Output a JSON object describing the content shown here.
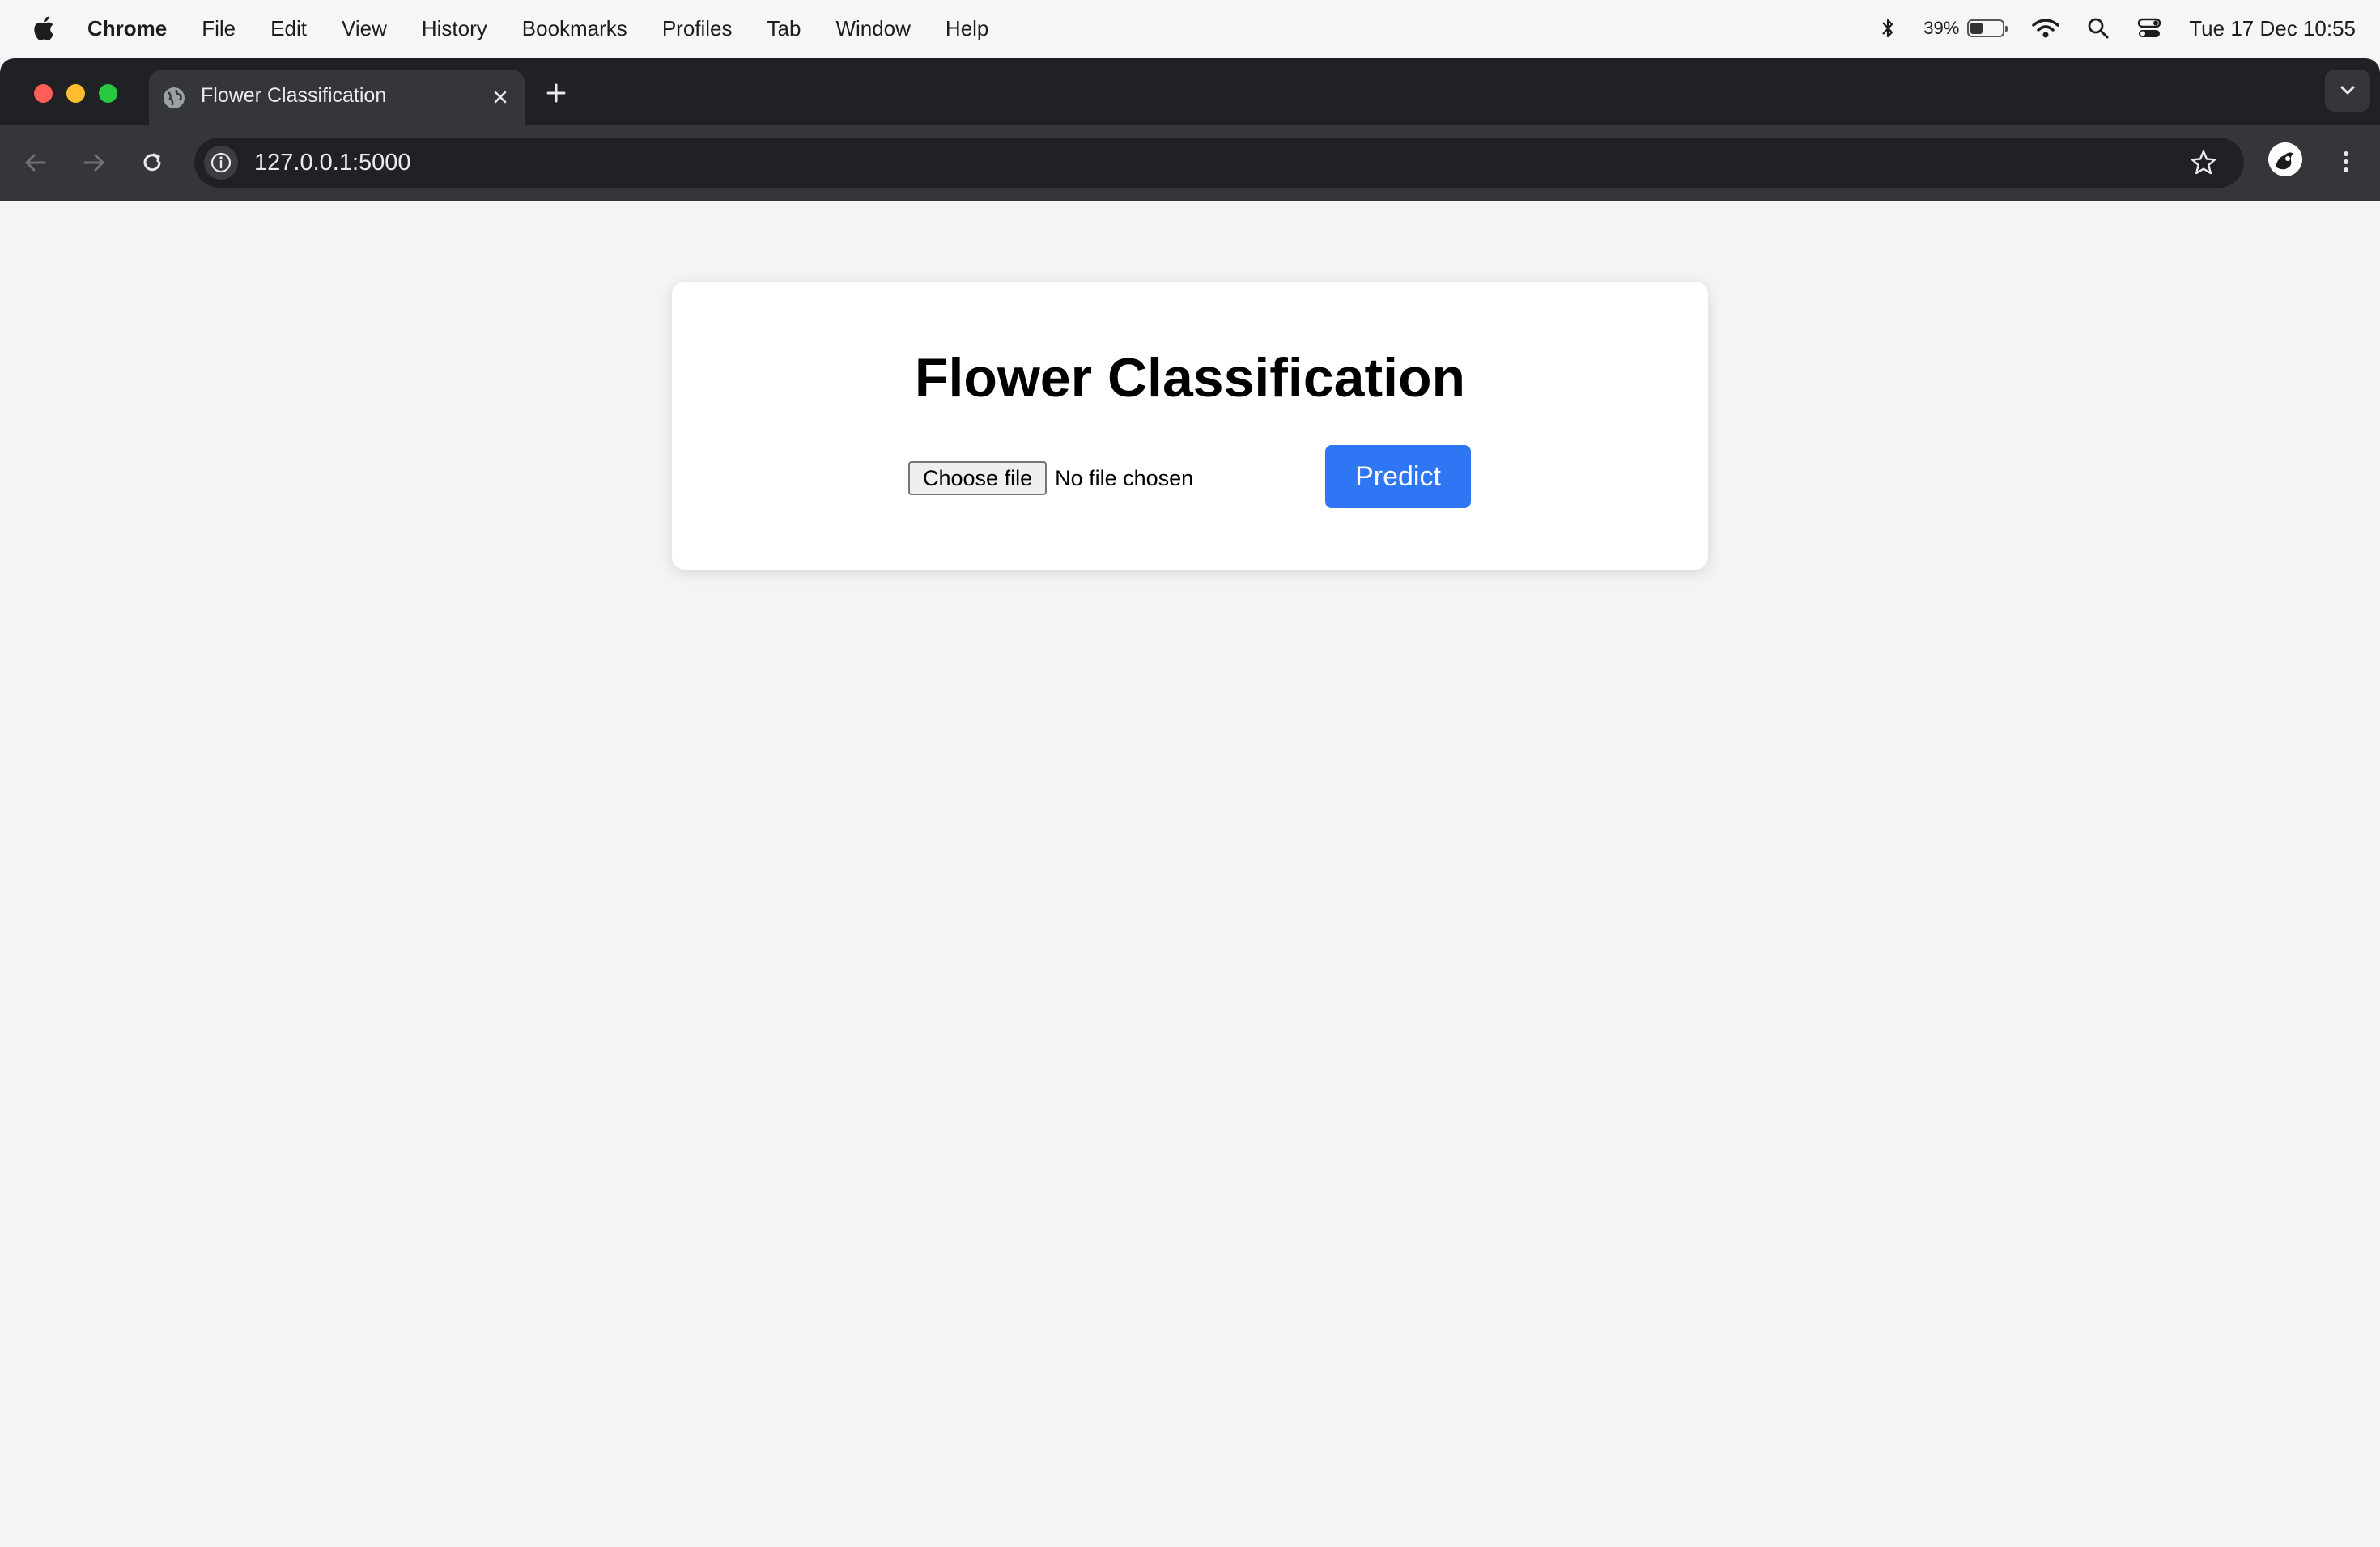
{
  "menubar": {
    "app_name": "Chrome",
    "items": [
      "File",
      "Edit",
      "View",
      "History",
      "Bookmarks",
      "Profiles",
      "Tab",
      "Window",
      "Help"
    ],
    "battery_percent": "39%",
    "battery_level": 0.39,
    "datetime": "Tue 17 Dec  10:55"
  },
  "browser": {
    "tab_title": "Flower Classification",
    "url": "127.0.0.1:5000"
  },
  "page": {
    "heading": "Flower Classification",
    "choose_file_label": "Choose file",
    "no_file_text": "No file chosen",
    "predict_label": "Predict"
  },
  "colors": {
    "predict_button": "#2f76f5",
    "page_background": "#f4f4f4",
    "browser_chrome": "#35363a"
  }
}
